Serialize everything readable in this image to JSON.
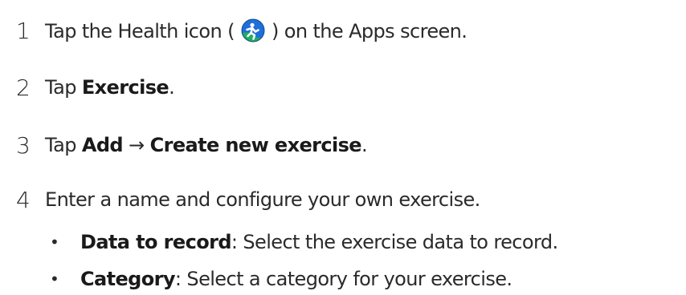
{
  "steps": [
    {
      "number": "1",
      "before_icon": "Tap the Health icon (",
      "icon": "health-app-icon",
      "after_icon": ") on the Apps screen."
    },
    {
      "number": "2",
      "prefix": "Tap ",
      "bold": "Exercise",
      "suffix": "."
    },
    {
      "number": "3",
      "prefix": "Tap ",
      "bold_1": "Add",
      "arrow": " → ",
      "bold_2": "Create new exercise",
      "suffix": "."
    },
    {
      "number": "4",
      "text": "Enter a name and configure your own exercise."
    }
  ],
  "bullets": [
    {
      "marker": "•",
      "term": "Data to record",
      "description": ": Select the exercise data to record."
    },
    {
      "marker": "•",
      "term": "Category",
      "description": ": Select a category for your exercise."
    }
  ],
  "colors": {
    "text": "#2a2a2a",
    "icon_blue": "#1e6fd9",
    "icon_green": "#1fae5b"
  }
}
